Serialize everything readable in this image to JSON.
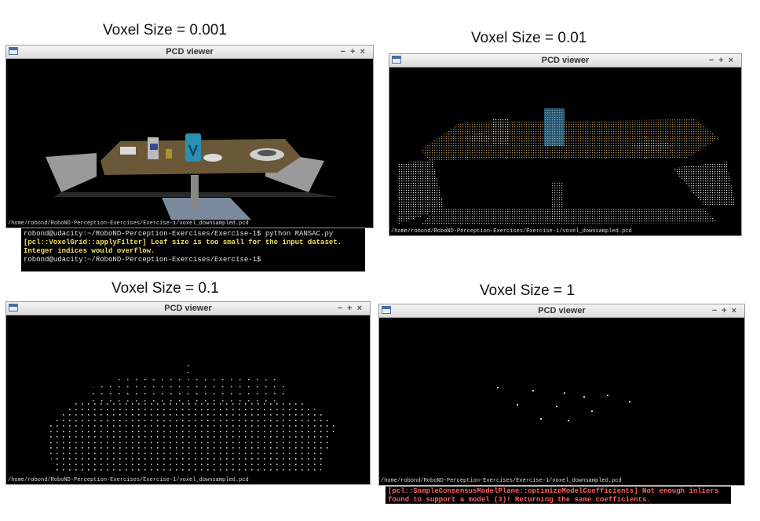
{
  "panels": [
    {
      "caption": "Voxel Size = 0.001",
      "window_title": "PCD viewer",
      "file_path": "/home/robond/RoboND-Perception-Exercises/Exercise-1/voxel_downsampled.pcd",
      "controls": [
        "−",
        "+",
        "×"
      ]
    },
    {
      "caption": "Voxel Size = 0.01",
      "window_title": "PCD viewer",
      "file_path": "/home/robond/RoboND-Perception-Exercises/Exercise-1/voxel_downsampled.pcd",
      "controls": [
        "−",
        "+",
        "×"
      ]
    },
    {
      "caption": "Voxel Size = 0.1",
      "window_title": "PCD viewer",
      "file_path": "/home/robond/RoboND-Perception-Exercises/Exercise-1/voxel_downsampled.pcd",
      "controls": [
        "−",
        "+",
        "×"
      ]
    },
    {
      "caption": "Voxel Size = 1",
      "window_title": "PCD viewer",
      "file_path": "/home/robond/RoboND-Perception-Exercises/Exercise-1/voxel_downsampled.pcd",
      "controls": [
        "−",
        "+",
        "×"
      ]
    }
  ],
  "terminal_top": {
    "prompt_line": "robond@udacity:~/RoboND-Perception-Exercises/Exercise-1$ python RANSAC.py",
    "warning_line": "[pcl::VoxelGrid::applyFilter] Leaf size is too small for the input dataset. Integer indices would overflow.",
    "trailing_prompt": "robond@udacity:~/RoboND-Perception-Exercises/Exercise-1$"
  },
  "terminal_bottom": {
    "error_line": "[pcl::SampleConsensusModelPlane::optimizeModelCoefficients] Not enough inliers found to support a model (3)! Returning the same coefficients."
  },
  "colors": {
    "viewer_bg": "#000000",
    "table_top": "#6b5838",
    "floor": "#9a9a9a",
    "can_blue": "#2a8fb0",
    "warning_yellow": "#f0e060",
    "error_red": "#ff6060"
  }
}
